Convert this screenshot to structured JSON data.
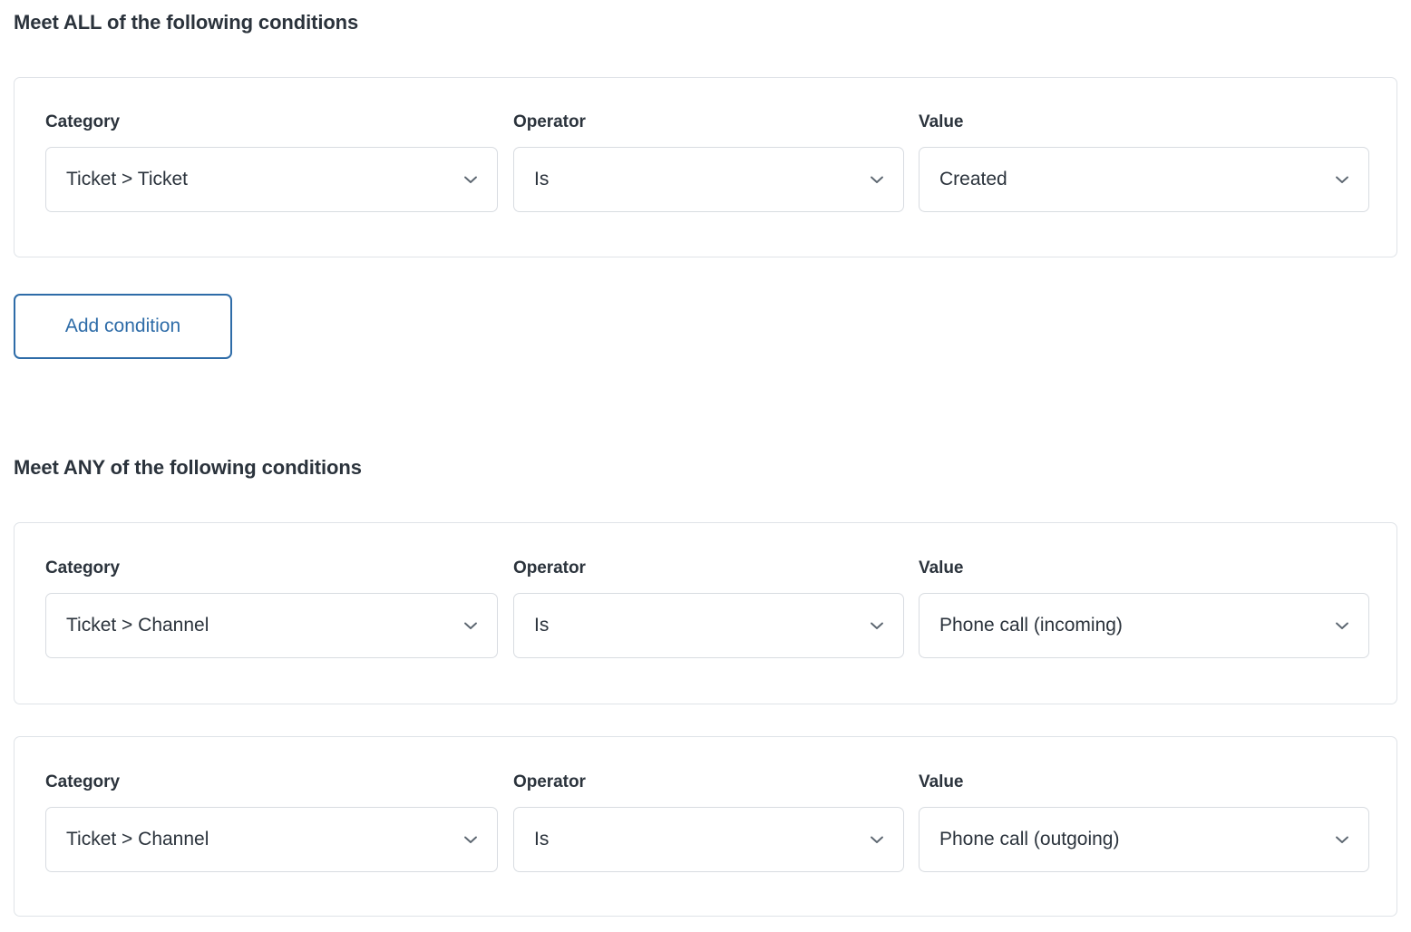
{
  "colors": {
    "text": "#2b333c",
    "card_border": "#dfe3e8",
    "field_border": "#d8dce1",
    "accent_blue": "#2e6ca8",
    "chevron": "#5c6670",
    "background": "#ffffff"
  },
  "sections": [
    {
      "heading": "Meet ALL of the following conditions",
      "conditions": [
        {
          "category": {
            "label": "Category",
            "value": "Ticket > Ticket",
            "icon": "chevron-down-icon"
          },
          "operator": {
            "label": "Operator",
            "value": "Is",
            "icon": "chevron-down-icon"
          },
          "value": {
            "label": "Value",
            "value": "Created",
            "icon": "chevron-down-icon"
          }
        }
      ],
      "add_button": "Add condition"
    },
    {
      "heading": "Meet ANY of the following conditions",
      "conditions": [
        {
          "category": {
            "label": "Category",
            "value": "Ticket > Channel",
            "icon": "chevron-down-icon"
          },
          "operator": {
            "label": "Operator",
            "value": "Is",
            "icon": "chevron-down-icon"
          },
          "value": {
            "label": "Value",
            "value": "Phone call (incoming)",
            "icon": "chevron-down-icon"
          }
        },
        {
          "category": {
            "label": "Category",
            "value": "Ticket > Channel",
            "icon": "chevron-down-icon"
          },
          "operator": {
            "label": "Operator",
            "value": "Is",
            "icon": "chevron-down-icon"
          },
          "value": {
            "label": "Value",
            "value": "Phone call (outgoing)",
            "icon": "chevron-down-icon"
          }
        }
      ]
    }
  ]
}
